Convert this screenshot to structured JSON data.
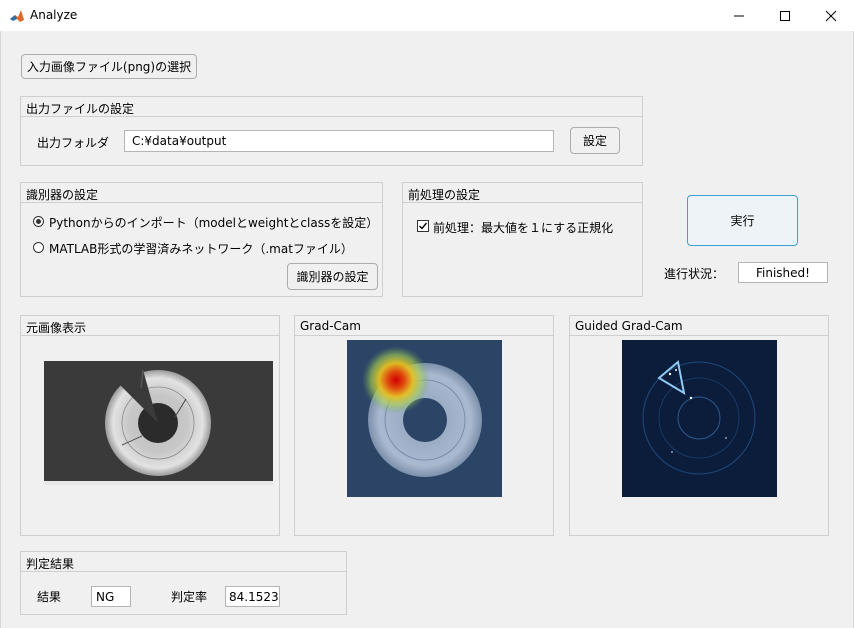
{
  "window": {
    "title": "Analyze"
  },
  "buttons": {
    "select_input": "入力画像ファイル(png)の選択",
    "output_setting": "設定",
    "classifier_setting": "識別器の設定",
    "run": "実行"
  },
  "output_panel": {
    "title": "出力ファイルの設定",
    "folder_label": "出力フォルダ",
    "folder_value": "C:¥data¥output"
  },
  "classifier_panel": {
    "title": "識別器の設定",
    "options": [
      {
        "label": "Pythonからのインポート（modelとweightとclassを設定）",
        "selected": true
      },
      {
        "label": "MATLAB形式の学習済みネットワーク（.matファイル）",
        "selected": false
      }
    ]
  },
  "preprocess_panel": {
    "title": "前処理の設定",
    "checkbox_label": "前処理：最大値を１にする正規化",
    "checked": true
  },
  "progress": {
    "label": "進行状況：",
    "value": "Finished!"
  },
  "images": {
    "original_title": "元画像表示",
    "gradcam_title": "Grad-Cam",
    "guided_title": "Guided Grad-Cam"
  },
  "result_panel": {
    "title": "判定結果",
    "result_label": "結果",
    "result_value": "NG",
    "rate_label": "判定率",
    "rate_value": "84.1523"
  },
  "colors": {
    "accent_button_border": "#3c9fd6",
    "gradcam_bg": "#2c4466",
    "guided_bg": "#0c1d3c"
  }
}
